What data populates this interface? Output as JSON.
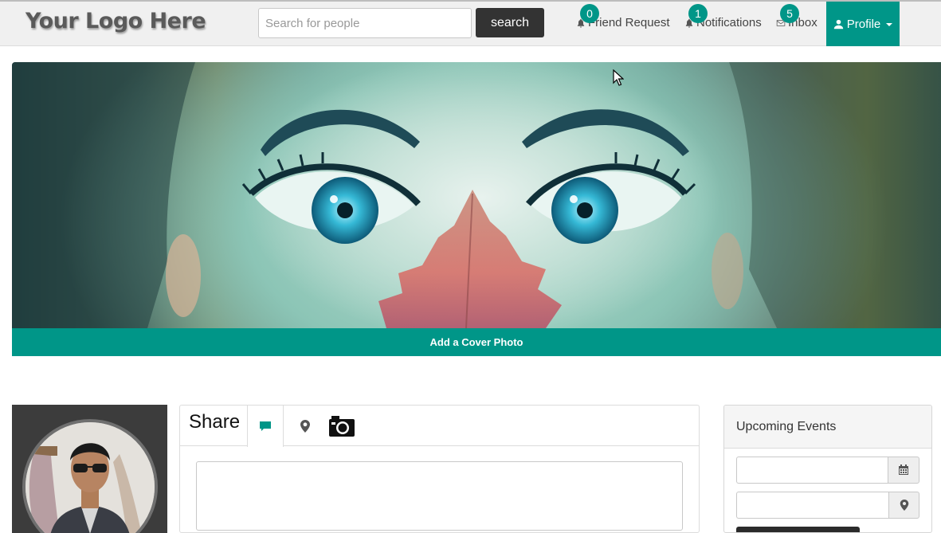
{
  "navbar": {
    "logo": "Your Logo Here",
    "search_placeholder": "Search for people",
    "search_button": "search",
    "links": [
      {
        "label": "Friend Request",
        "badge": "0",
        "icon": "bell-icon"
      },
      {
        "label": "Notifications",
        "badge": "1",
        "icon": "bell-icon"
      },
      {
        "label": "Inbox",
        "badge": "5",
        "icon": "envelope-icon"
      }
    ],
    "profile": {
      "label": "Profile",
      "icon": "user-icon"
    }
  },
  "cover": {
    "button": "Add a Cover Photo"
  },
  "share": {
    "title": "Share",
    "tabs": [
      {
        "icon": "comment-icon",
        "active": true
      },
      {
        "icon": "map-marker-icon",
        "active": false
      },
      {
        "icon": "camera-icon",
        "active": false
      }
    ],
    "text_value": ""
  },
  "events": {
    "title": "Upcoming Events",
    "date_value": "",
    "place_value": "",
    "date_icon": "calendar-icon",
    "place_icon": "map-marker-icon"
  },
  "colors": {
    "accent": "#009688",
    "dark": "#333333",
    "navbar_bg": "#f0f0f0"
  }
}
